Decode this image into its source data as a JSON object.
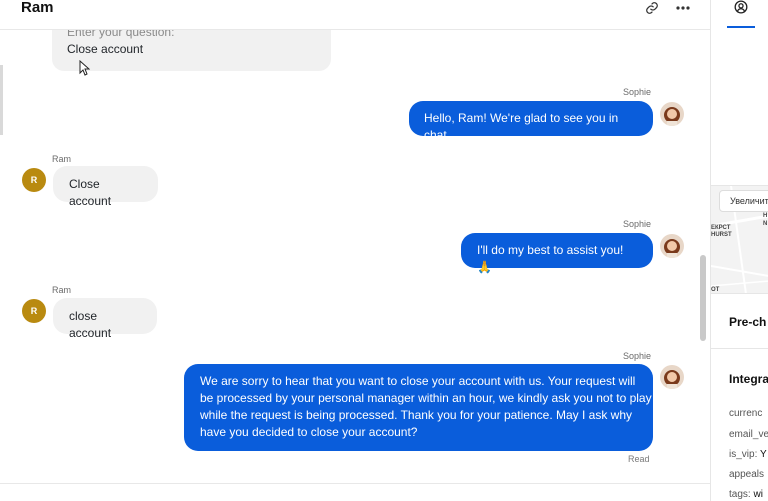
{
  "header": {
    "title": "Ram"
  },
  "messages": {
    "quoted": {
      "label": "Enter your question:",
      "text": "Close account"
    },
    "m1": {
      "sender": "Sophie",
      "text": "Hello, Ram! We're glad to see you in chat."
    },
    "m2": {
      "sender": "Ram",
      "avatar": "R",
      "text": "Close account"
    },
    "m3": {
      "sender": "Sophie",
      "text": "I'll do my best to assist you! 🙏"
    },
    "m4": {
      "sender": "Ram",
      "avatar": "R",
      "text": "close account"
    },
    "m5": {
      "sender": "Sophie",
      "lines": [
        "We are sorry to hear that you want to close your account with us. Your request will",
        "be processed by your personal manager within an hour, we kindly ask you not to play",
        "while the request is being processed. Thank you for your patience. May I ask why",
        "have you decided to close your account?"
      ],
      "status": "Read"
    }
  },
  "right_panel": {
    "map_zoom": "Увеличит",
    "map_labels": [
      "H",
      "N",
      "ЕКРСТ",
      "HURST",
      "OT"
    ],
    "pre_chat": "Pre-ch",
    "integrations": "Integra",
    "fields": [
      {
        "key": "currenc",
        "value": ""
      },
      {
        "key": "email_ve",
        "value": ""
      },
      {
        "key": "is_vip: ",
        "value": "Y"
      },
      {
        "key": "appeals",
        "value": ""
      },
      {
        "key": "tags: ",
        "value": "wi"
      }
    ]
  },
  "colors": {
    "accent": "#0a5ddb",
    "avatar_ram": "#b98a10",
    "incoming_bubble": "#f1f1f1"
  }
}
